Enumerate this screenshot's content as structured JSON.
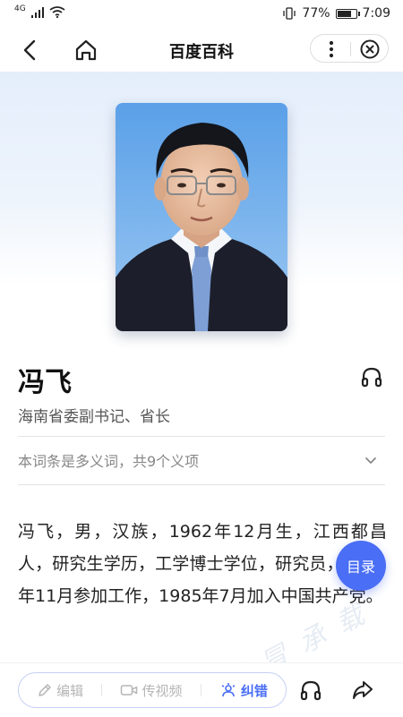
{
  "status_bar": {
    "signal_label": "4G",
    "battery_percent": "77%",
    "battery_level": 0.77,
    "time": "7:09"
  },
  "nav": {
    "title": "百度百科"
  },
  "entry": {
    "name": "冯飞",
    "description": "海南省委副书记、省长",
    "polysemy_note": "本词条是多义词，共9个义项",
    "summary": "冯飞，男，汉族，1962年12月生，江西都昌人，研究生学历，工学博士学位，研究员，1991年11月参加工作，1985年7月加入中国共产党。"
  },
  "toc_button": {
    "label": "目录"
  },
  "watermark": {
    "text": "将 冒 承 载"
  },
  "toolbar": {
    "edit_label": "编辑",
    "video_label": "传视频",
    "report_label": "纠错"
  },
  "colors": {
    "accent": "#4a6ef5",
    "hero_bg": "#e4eefb"
  }
}
